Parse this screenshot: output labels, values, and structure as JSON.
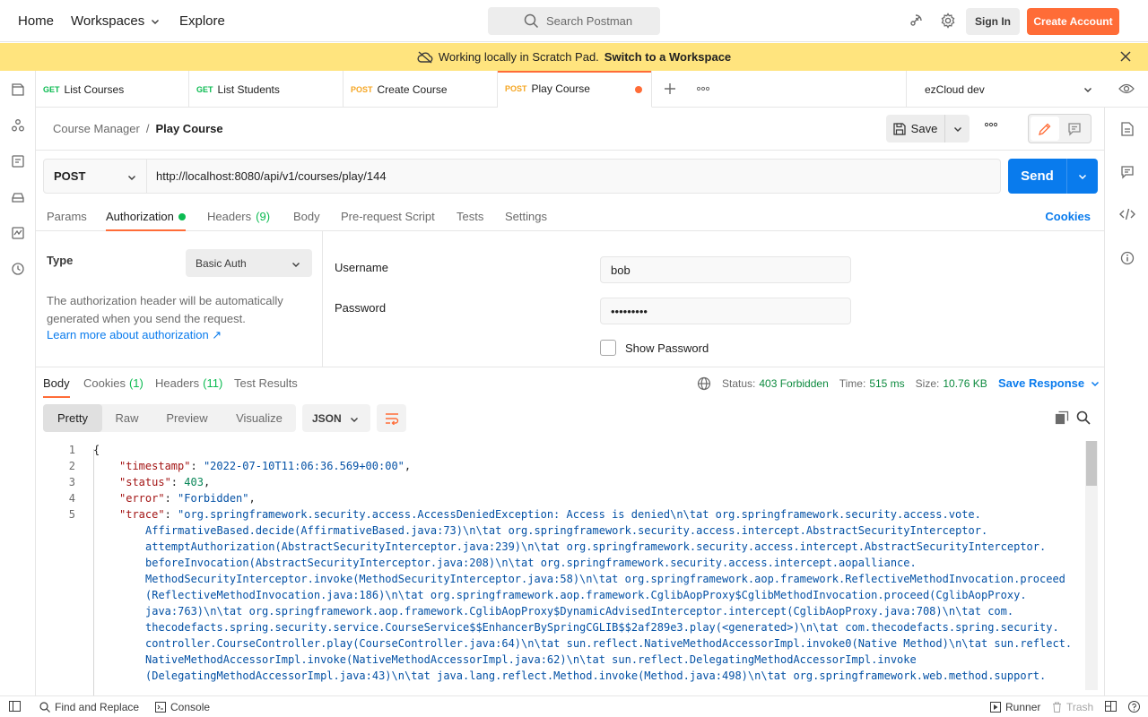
{
  "header": {
    "nav": [
      "Home",
      "Workspaces",
      "Explore"
    ],
    "search_placeholder": "Search Postman",
    "sign_in": "Sign In",
    "create_account": "Create Account"
  },
  "banner": {
    "text": "Working locally in Scratch Pad.",
    "link": "Switch to a Workspace"
  },
  "tabs": [
    {
      "method": "GET",
      "name": "List Courses"
    },
    {
      "method": "GET",
      "name": "List Students"
    },
    {
      "method": "POST",
      "name": "Create Course"
    },
    {
      "method": "POST",
      "name": "Play Course"
    }
  ],
  "environment": "ezCloud dev",
  "breadcrumb": {
    "parent": "Course Manager",
    "separator": "/",
    "current": "Play Course"
  },
  "toolbar": {
    "save": "Save"
  },
  "request": {
    "method": "POST",
    "url": "http://localhost:8080/api/v1/courses/play/144",
    "send": "Send",
    "tabs": {
      "params": "Params",
      "authorization": "Authorization",
      "headers": "Headers",
      "headers_count": "(9)",
      "body": "Body",
      "prerequest": "Pre-request Script",
      "tests": "Tests",
      "settings": "Settings"
    },
    "cookies": "Cookies"
  },
  "auth": {
    "type_label": "Type",
    "type_value": "Basic Auth",
    "description": "The authorization header will be automatically generated when you send the request.",
    "learn_more": "Learn more about authorization ↗",
    "username_label": "Username",
    "username_value": "bob",
    "password_label": "Password",
    "password_value": "•••••••••",
    "show_password": "Show Password"
  },
  "response": {
    "tabs": {
      "body": "Body",
      "cookies": "Cookies",
      "cookies_count": "(1)",
      "headers": "Headers",
      "headers_count": "(11)",
      "tests": "Test Results"
    },
    "status_label": "Status:",
    "status_value": "403 Forbidden",
    "time_label": "Time:",
    "time_value": "515 ms",
    "size_label": "Size:",
    "size_value": "10.76 KB",
    "save_response": "Save Response",
    "view_tabs": [
      "Pretty",
      "Raw",
      "Preview",
      "Visualize"
    ],
    "format": "JSON",
    "lines": [
      {
        "n": "1",
        "key": "",
        "val": "{"
      },
      {
        "n": "2",
        "key": "\"timestamp\"",
        "val": "\"2022-07-10T11:06:36.569+00:00\""
      },
      {
        "n": "3",
        "key": "\"status\"",
        "val": "403"
      },
      {
        "n": "4",
        "key": "\"error\"",
        "val": "\"Forbidden\""
      },
      {
        "n": "5",
        "key": "\"trace\"",
        "val": "\"org.springframework.security.access.AccessDeniedException: Access is denied\\n\\tat org.springframework.security.access.vote."
      }
    ],
    "trace_wrap": [
      "AffirmativeBased.decide(AffirmativeBased.java:73)\\n\\tat org.springframework.security.access.intercept.AbstractSecurityInterceptor.",
      "attemptAuthorization(AbstractSecurityInterceptor.java:239)\\n\\tat org.springframework.security.access.intercept.AbstractSecurityInterceptor.",
      "beforeInvocation(AbstractSecurityInterceptor.java:208)\\n\\tat org.springframework.security.access.intercept.aopalliance.",
      "MethodSecurityInterceptor.invoke(MethodSecurityInterceptor.java:58)\\n\\tat org.springframework.aop.framework.ReflectiveMethodInvocation.proceed",
      "(ReflectiveMethodInvocation.java:186)\\n\\tat org.springframework.aop.framework.CglibAopProxy$CglibMethodInvocation.proceed(CglibAopProxy.",
      "java:763)\\n\\tat org.springframework.aop.framework.CglibAopProxy$DynamicAdvisedInterceptor.intercept(CglibAopProxy.java:708)\\n\\tat com.",
      "thecodefacts.spring.security.service.CourseService$$EnhancerBySpringCGLIB$$2af289e3.play(<generated>)\\n\\tat com.thecodefacts.spring.security.",
      "controller.CourseController.play(CourseController.java:64)\\n\\tat sun.reflect.NativeMethodAccessorImpl.invoke0(Native Method)\\n\\tat sun.reflect.",
      "NativeMethodAccessorImpl.invoke(NativeMethodAccessorImpl.java:62)\\n\\tat sun.reflect.DelegatingMethodAccessorImpl.invoke",
      "(DelegatingMethodAccessorImpl.java:43)\\n\\tat java.lang.reflect.Method.invoke(Method.java:498)\\n\\tat org.springframework.web.method.support."
    ]
  },
  "footer": {
    "find_replace": "Find and Replace",
    "console": "Console",
    "runner": "Runner",
    "trash": "Trash"
  },
  "colors": {
    "accent": "#ff6c37",
    "primary": "#097bed",
    "banner": "#ffe47e",
    "success": "#0cbb52"
  }
}
